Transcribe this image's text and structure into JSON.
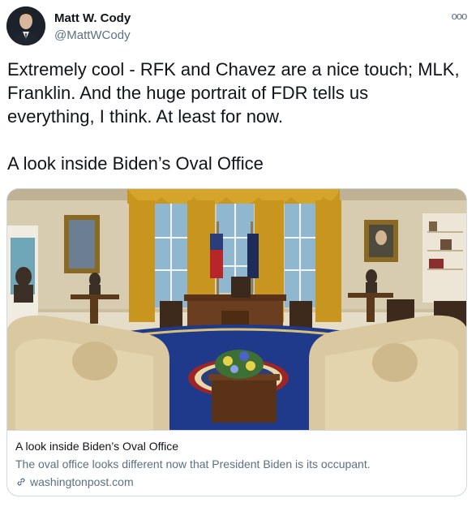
{
  "author": {
    "name": "Matt W. Cody",
    "handle": "@MattWCody"
  },
  "menu": {
    "more_label": "ooo"
  },
  "tweet": {
    "text": "Extremely cool - RFK and Chavez are a nice touch; MLK,\nFranklin. And the huge portrait of FDR tells us\neverything, I think. At least for now.\n\nA look inside Biden’s Oval Office"
  },
  "card": {
    "title": "A look inside Biden’s Oval Office",
    "description": "The oval office looks different now that President Biden is its occupant.",
    "domain": "washingtonpost.com",
    "link_icon": "link-icon"
  },
  "colors": {
    "text_primary": "#0f1419",
    "text_secondary": "#5b7083",
    "border": "#cfd9de",
    "rug_blue": "#1f3a8a",
    "drapes_gold": "#c8961e"
  }
}
